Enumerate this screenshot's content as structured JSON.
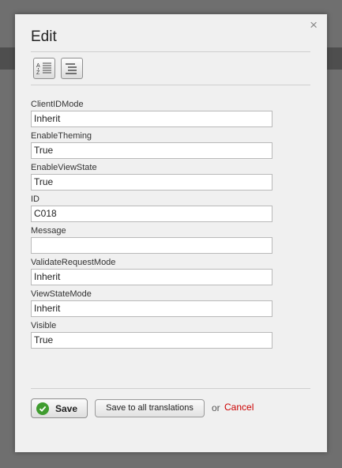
{
  "dialog": {
    "title": "Edit",
    "close_glyph": "×"
  },
  "toolbar": {
    "sort_icon": "sort-alphabetical-icon",
    "categorized_icon": "categorized-list-icon"
  },
  "fields": [
    {
      "label": "ClientIDMode",
      "value": "Inherit"
    },
    {
      "label": "EnableTheming",
      "value": "True"
    },
    {
      "label": "EnableViewState",
      "value": "True"
    },
    {
      "label": "ID",
      "value": "C018"
    },
    {
      "label": "Message",
      "value": ""
    },
    {
      "label": "ValidateRequestMode",
      "value": "Inherit"
    },
    {
      "label": "ViewStateMode",
      "value": "Inherit"
    },
    {
      "label": "Visible",
      "value": "True"
    }
  ],
  "actions": {
    "save_label": "Save",
    "save_all_label": "Save to all translations",
    "or_text": "or",
    "cancel_label": "Cancel"
  },
  "colors": {
    "cancel": "#cc0000",
    "save_check": "#3f9c2f"
  }
}
